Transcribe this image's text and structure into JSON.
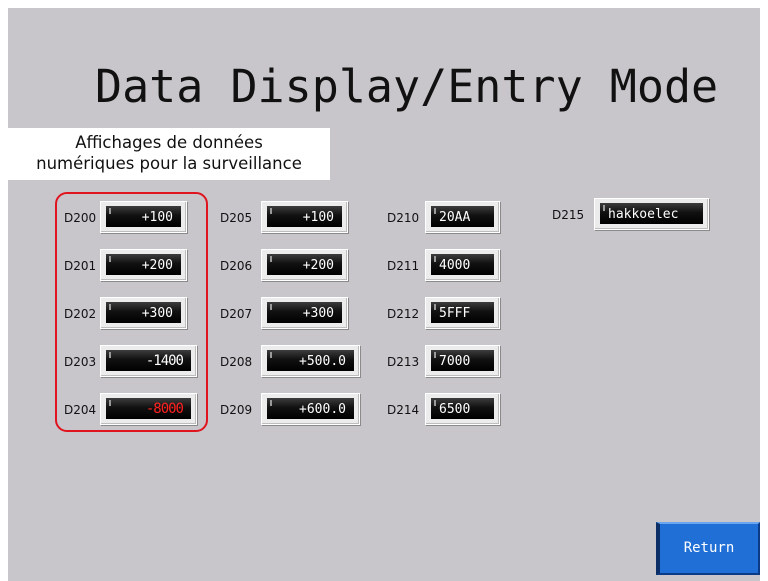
{
  "title": "Data Display/Entry Mode",
  "caption": {
    "line1": "Affichages de données",
    "line2": "numériques pour la surveillance"
  },
  "columns": [
    [
      {
        "reg": "D200",
        "value": "+100"
      },
      {
        "reg": "D201",
        "value": "+200"
      },
      {
        "reg": "D202",
        "value": "+300"
      },
      {
        "reg": "D203",
        "value": "-1400"
      },
      {
        "reg": "D204",
        "value": "-8000"
      }
    ],
    [
      {
        "reg": "D205",
        "value": "+100"
      },
      {
        "reg": "D206",
        "value": "+200"
      },
      {
        "reg": "D207",
        "value": "+300"
      },
      {
        "reg": "D208",
        "value": "+500.0"
      },
      {
        "reg": "D209",
        "value": "+600.0"
      }
    ],
    [
      {
        "reg": "D210",
        "value": "20AA"
      },
      {
        "reg": "D211",
        "value": "4000"
      },
      {
        "reg": "D212",
        "value": "5FFF"
      },
      {
        "reg": "D213",
        "value": "7000"
      },
      {
        "reg": "D214",
        "value": "6500"
      }
    ],
    [
      {
        "reg": "D215",
        "value": "hakkoelec"
      }
    ]
  ],
  "colors": {
    "background": "#c8c6cb",
    "highlight": "#e0141e",
    "negative_value": "#ff2020",
    "return_button": "#1f6fd6"
  },
  "return_button": {
    "label": "Return"
  }
}
